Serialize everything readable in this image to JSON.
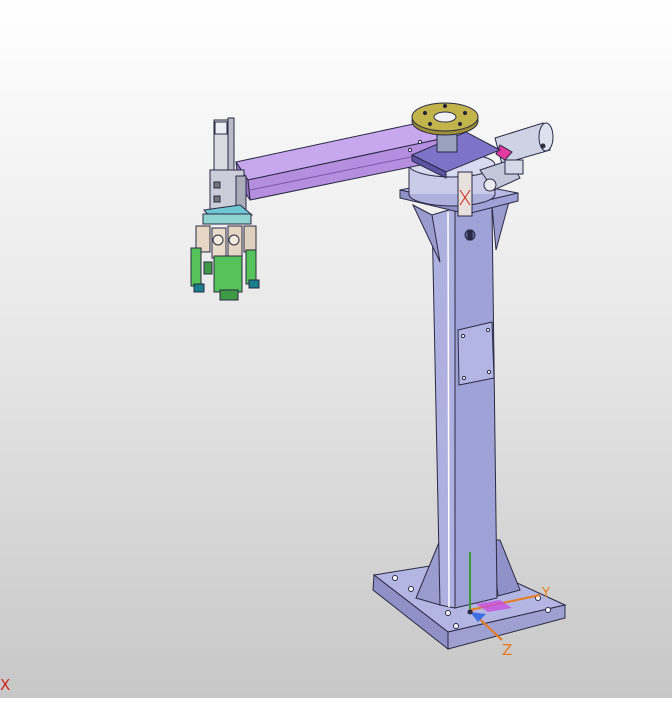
{
  "viewport": {
    "model_name": "",
    "background_top": "#ffffff",
    "background_bottom": "#c7c7c7"
  },
  "colors": {
    "column": "#aeb0e0",
    "column_shade": "#8f91c8",
    "arm": "#b58ee0",
    "arm_shade": "#9470c4",
    "flange": "#c2b44a",
    "gripper": "#55c25a",
    "gripper_shade": "#3f9a46",
    "motor": "#cdd3e4",
    "accent_red": "#d0231c",
    "axis_x": "#d0231c",
    "axis_y": "#e87a1a",
    "axis_z": "#e87a1a"
  },
  "axes": {
    "x_label": "X",
    "y_label": "Y",
    "z_label": "Z"
  }
}
